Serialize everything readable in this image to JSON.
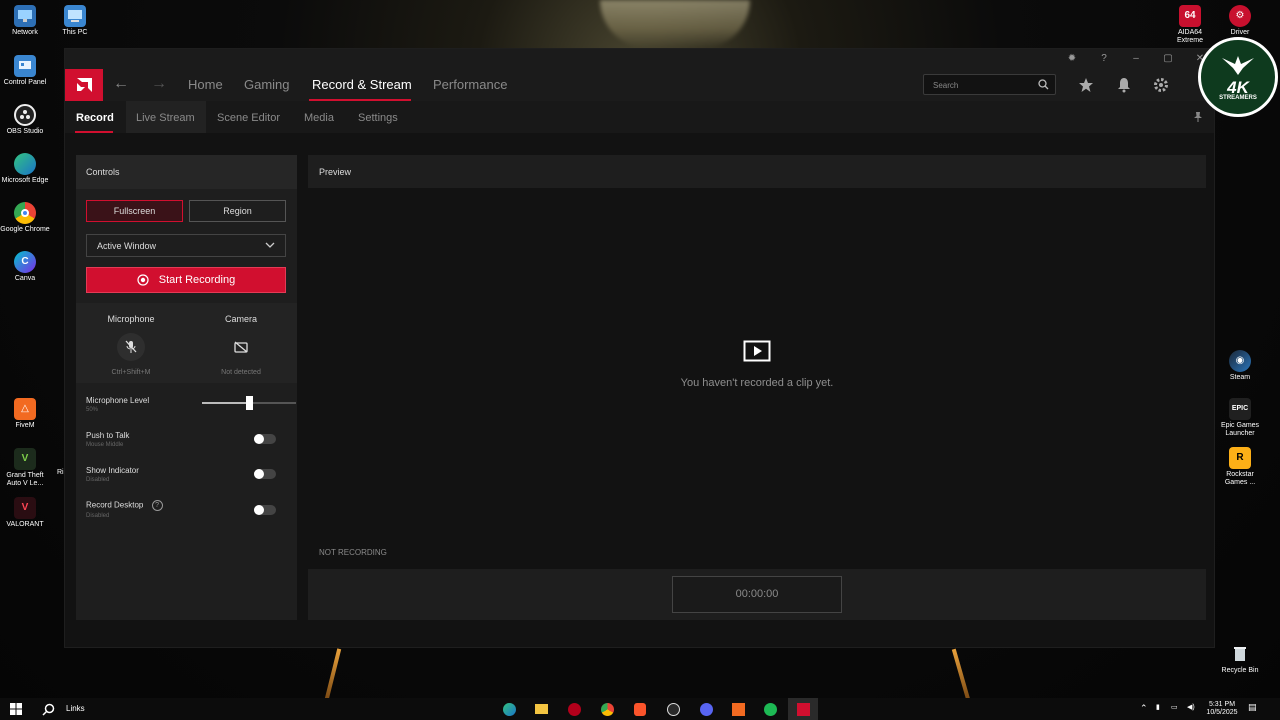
{
  "desktop": {
    "left_icons": [
      {
        "label": "Network",
        "icon": "network-icon"
      },
      {
        "label": "This PC",
        "icon": "computer-icon"
      },
      {
        "label": "Control Panel",
        "icon": "control-panel-icon"
      },
      {
        "label": "OBS Studio",
        "icon": "obs-icon"
      },
      {
        "label": "Microsoft Edge",
        "icon": "edge-icon"
      },
      {
        "label": "Google Chrome",
        "icon": "chrome-icon"
      },
      {
        "label": "Canva",
        "icon": "canva-icon"
      },
      {
        "label": "FiveM",
        "icon": "fivem-icon"
      },
      {
        "label": "Grand Theft Auto V Le...",
        "icon": "gta-icon"
      },
      {
        "label": "VALORANT",
        "icon": "valorant-icon"
      }
    ],
    "partial_label": "Ri",
    "right_icons": [
      {
        "label": "AIDA64 Extreme",
        "icon": "aida64-icon"
      },
      {
        "label": "Driver",
        "icon": "driver-icon"
      },
      {
        "label": "Steam",
        "icon": "steam-icon"
      },
      {
        "label": "Epic Games Launcher",
        "icon": "epic-icon"
      },
      {
        "label": "Rockstar Games ...",
        "icon": "rockstar-icon"
      },
      {
        "label": "Recycle Bin",
        "icon": "recycle-bin-icon"
      }
    ],
    "aida_badge": "64"
  },
  "app": {
    "nav": {
      "items": [
        "Home",
        "Gaming",
        "Record & Stream",
        "Performance"
      ],
      "active": "Record & Stream"
    },
    "search": {
      "placeholder": "Search"
    },
    "subnav": {
      "items": [
        "Record",
        "Live Stream",
        "Scene Editor",
        "Media",
        "Settings"
      ],
      "active": "Record"
    },
    "controls": {
      "title": "Controls",
      "fullscreen_label": "Fullscreen",
      "region_label": "Region",
      "capture_mode": "Active Window",
      "start_recording_label": "Start Recording",
      "microphone": {
        "title": "Microphone",
        "hotkey": "Ctrl+Shift+M"
      },
      "camera": {
        "title": "Camera",
        "status": "Not detected"
      },
      "mic_level": {
        "label": "Microphone Level",
        "value_text": "50%",
        "value": 0.5
      },
      "push_to_talk": {
        "label": "Push to Talk",
        "sub": "Mouse Middle",
        "on": false
      },
      "show_indicator": {
        "label": "Show Indicator",
        "sub": "Disabled",
        "on": false
      },
      "record_desktop": {
        "label": "Record Desktop",
        "sub": "Disabled",
        "help": "?",
        "on": false
      }
    },
    "preview": {
      "title": "Preview",
      "empty_message": "You haven't recorded a clip yet.",
      "status": "NOT RECORDING",
      "timer": "00:00:00"
    }
  },
  "badge": {
    "text": "4K",
    "sub": "STREAMERS"
  },
  "taskbar": {
    "links_label": "Links",
    "time": "5:31 PM",
    "date": "10/5/2025"
  },
  "colors": {
    "accent": "#d10f2f",
    "panel": "#1e1e1e",
    "background": "#121212"
  }
}
